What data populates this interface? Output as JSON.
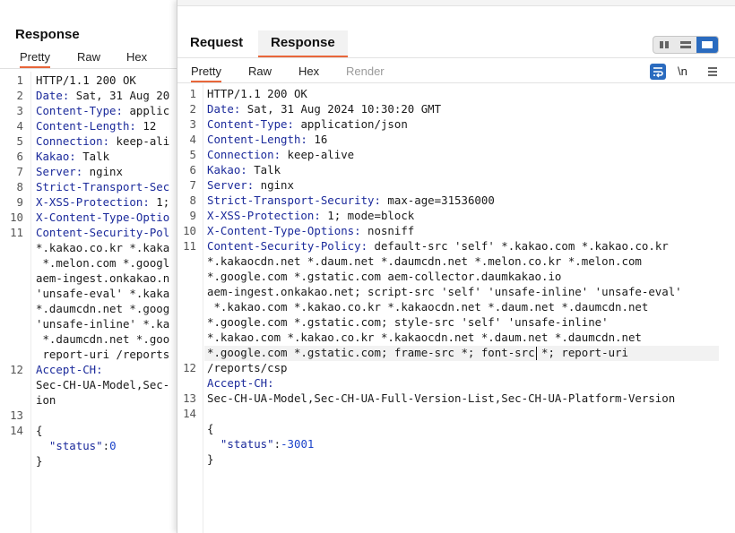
{
  "back": {
    "title": "Response",
    "tabs": [
      "Pretty",
      "Raw",
      "Hex"
    ],
    "line_numbers": [
      "1",
      "2",
      "3",
      "4",
      "5",
      "6",
      "7",
      "8",
      "9",
      "10",
      "11",
      "12",
      "13",
      "14"
    ],
    "lines": [
      [
        [
          "plain",
          "HTTP/1.1 200 OK"
        ]
      ],
      [
        [
          "name",
          "Date:"
        ],
        [
          "plain",
          " Sat, 31 Aug 20"
        ]
      ],
      [
        [
          "name",
          "Content-Type:"
        ],
        [
          "plain",
          " applic"
        ]
      ],
      [
        [
          "name",
          "Content-Length:"
        ],
        [
          "plain",
          " 12"
        ]
      ],
      [
        [
          "name",
          "Connection:"
        ],
        [
          "plain",
          " keep-ali"
        ]
      ],
      [
        [
          "name",
          "Kakao:"
        ],
        [
          "plain",
          " Talk"
        ]
      ],
      [
        [
          "name",
          "Server:"
        ],
        [
          "plain",
          " nginx"
        ]
      ],
      [
        [
          "name",
          "Strict-Transport-Sec"
        ]
      ],
      [
        [
          "name",
          "X-XSS-Protection:"
        ],
        [
          "plain",
          " 1;"
        ]
      ],
      [
        [
          "name",
          "X-Content-Type-Optio"
        ]
      ],
      [
        [
          "name",
          "Content-Security-Pol"
        ]
      ],
      [
        [
          "plain",
          "*.kakao.co.kr *.kaka"
        ]
      ],
      [
        [
          "plain",
          " *.melon.com *.googl"
        ]
      ],
      [
        [
          "plain",
          "aem-ingest.onkakao.n"
        ]
      ],
      [
        [
          "plain",
          "'unsafe-eval' *.kaka"
        ]
      ],
      [
        [
          "plain",
          "*.daumcdn.net *.goog"
        ]
      ],
      [
        [
          "plain",
          "'unsafe-inline' *.ka"
        ]
      ],
      [
        [
          "plain",
          " *.daumcdn.net *.goo"
        ]
      ],
      [
        [
          "plain",
          " report-uri /reports"
        ]
      ],
      [
        [
          "name",
          "Accept-CH:"
        ]
      ],
      [
        [
          "plain",
          "Sec-CH-UA-Model,Sec-"
        ]
      ],
      [
        [
          "plain",
          "ion"
        ]
      ],
      [
        [
          "plain",
          ""
        ]
      ],
      [
        [
          "plain",
          "{"
        ]
      ],
      [
        [
          "plain",
          "  "
        ],
        [
          "jkey",
          "\"status\""
        ],
        [
          "plain",
          ":"
        ],
        [
          "jval",
          "0"
        ]
      ],
      [
        [
          "plain",
          "}"
        ]
      ]
    ],
    "line_number_rows": [
      0,
      1,
      2,
      3,
      4,
      5,
      6,
      7,
      8,
      9,
      10,
      19,
      22,
      23
    ]
  },
  "front": {
    "main_tabs": [
      "Request",
      "Response"
    ],
    "view_tabs": [
      "Pretty",
      "Raw",
      "Hex",
      "Render"
    ],
    "newline_toggle": "\\n",
    "line_numbers": [
      "1",
      "2",
      "3",
      "4",
      "5",
      "6",
      "7",
      "8",
      "9",
      "10",
      "11",
      "12",
      "13",
      "14"
    ],
    "line_number_rows": [
      0,
      1,
      2,
      3,
      4,
      5,
      6,
      7,
      8,
      9,
      10,
      18,
      20,
      21
    ],
    "lines": [
      [
        [
          "plain",
          "HTTP/1.1 200 OK"
        ]
      ],
      [
        [
          "name",
          "Date:"
        ],
        [
          "plain",
          " Sat, 31 Aug 2024 10:30:20 GMT"
        ]
      ],
      [
        [
          "name",
          "Content-Type:"
        ],
        [
          "plain",
          " application/json"
        ]
      ],
      [
        [
          "name",
          "Content-Length:"
        ],
        [
          "plain",
          " 16"
        ]
      ],
      [
        [
          "name",
          "Connection:"
        ],
        [
          "plain",
          " keep-alive"
        ]
      ],
      [
        [
          "name",
          "Kakao:"
        ],
        [
          "plain",
          " Talk"
        ]
      ],
      [
        [
          "name",
          "Server:"
        ],
        [
          "plain",
          " nginx"
        ]
      ],
      [
        [
          "name",
          "Strict-Transport-Security:"
        ],
        [
          "plain",
          " max-age=31536000"
        ]
      ],
      [
        [
          "name",
          "X-XSS-Protection:"
        ],
        [
          "plain",
          " 1; mode=block"
        ]
      ],
      [
        [
          "name",
          "X-Content-Type-Options:"
        ],
        [
          "plain",
          " nosniff"
        ]
      ],
      [
        [
          "name",
          "Content-Security-Policy:"
        ],
        [
          "plain",
          " default-src 'self' *.kakao.com *.kakao.co.kr"
        ]
      ],
      [
        [
          "plain",
          "*.kakaocdn.net *.daum.net *.daumcdn.net *.melon.co.kr *.melon.com"
        ]
      ],
      [
        [
          "plain",
          "*.google.com *.gstatic.com aem-collector.daumkakao.io"
        ]
      ],
      [
        [
          "plain",
          "aem-ingest.onkakao.net; script-src 'self' 'unsafe-inline' 'unsafe-eval'"
        ]
      ],
      [
        [
          "plain",
          " *.kakao.com *.kakao.co.kr *.kakaocdn.net *.daum.net *.daumcdn.net"
        ]
      ],
      [
        [
          "plain",
          "*.google.com *.gstatic.com; style-src 'self' 'unsafe-inline'"
        ]
      ],
      [
        [
          "plain",
          "*.kakao.com *.kakao.co.kr *.kakaocdn.net *.daum.net *.daumcdn.net"
        ]
      ],
      [
        [
          "plain",
          "*.google.com *.gstatic.com; frame-src *; font-src *; report-uri"
        ]
      ],
      [
        [
          "plain",
          "/reports/csp"
        ]
      ],
      [
        [
          "name",
          "Accept-CH:"
        ]
      ],
      [
        [
          "plain",
          "Sec-CH-UA-Model,Sec-CH-UA-Full-Version-List,Sec-CH-UA-Platform-Version"
        ]
      ],
      [
        [
          "plain",
          ""
        ]
      ],
      [
        [
          "plain",
          "{"
        ]
      ],
      [
        [
          "plain",
          "  "
        ],
        [
          "jkey",
          "\"status\""
        ],
        [
          "plain",
          ":"
        ],
        [
          "jval",
          "-3001"
        ]
      ],
      [
        [
          "plain",
          "}"
        ]
      ]
    ]
  }
}
